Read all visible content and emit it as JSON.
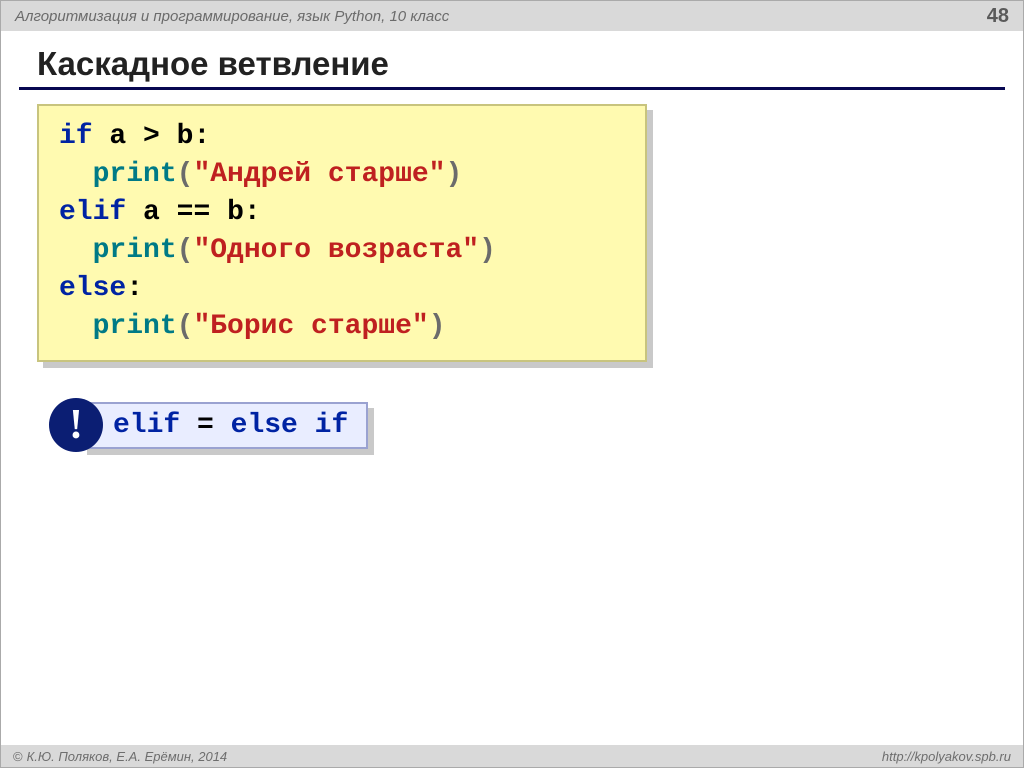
{
  "header": {
    "subject": "Алгоритмизация и программирование, язык Python, 10 класс",
    "page_number": "48"
  },
  "title": "Каскадное ветвление",
  "code": {
    "tokens": {
      "if_kw": "if",
      "elif_kw": "elif",
      "else_kw": "else",
      "print_fn": "print",
      "cond1_var_a": "a",
      "cond1_op": ">",
      "cond1_var_b": "b",
      "cond2_var_a": "a",
      "cond2_op": "==",
      "cond2_var_b": "b",
      "colon": ":",
      "lparen": "(",
      "rparen": ")",
      "str1": "\"Андрей старше\"",
      "str2": "\"Одного возраста\"",
      "str3": "\"Борис старше\""
    }
  },
  "note": {
    "bang": "!",
    "lhs": "elif",
    "eq": " = ",
    "rhs": "else if"
  },
  "footer": {
    "authors": "К.Ю. Поляков, Е.А. Ерёмин, 2014",
    "url": "http://kpolyakov.spb.ru"
  }
}
